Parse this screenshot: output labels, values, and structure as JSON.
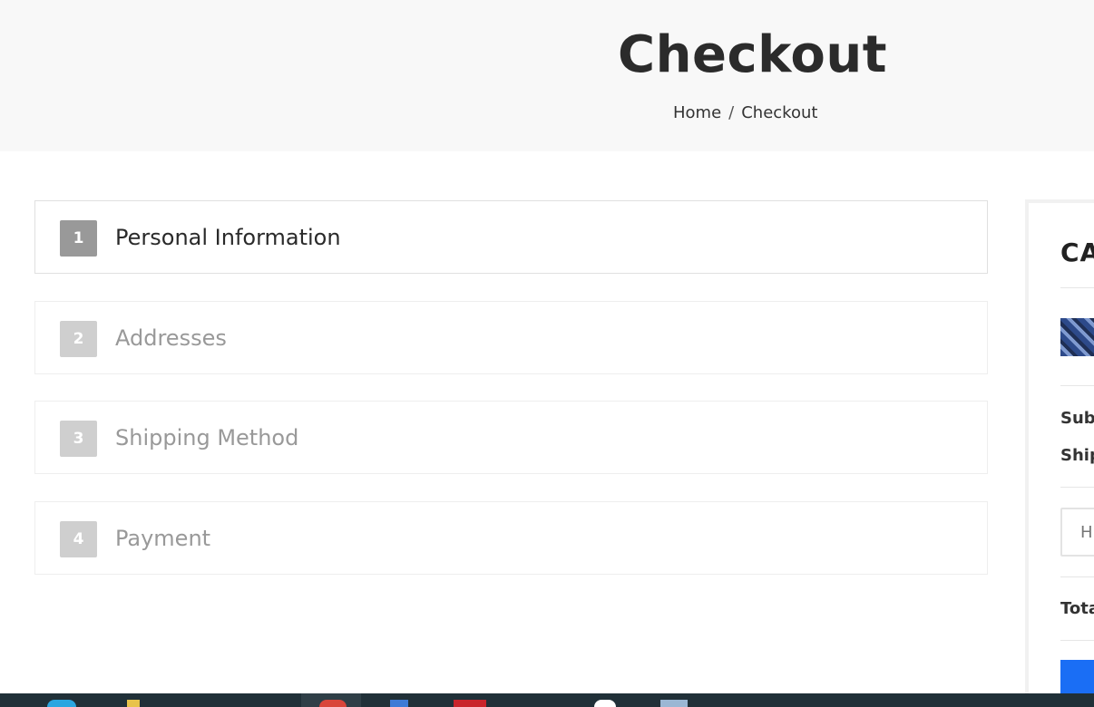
{
  "header": {
    "title": "Checkout",
    "breadcrumb": {
      "home": "Home",
      "separator": "/",
      "current": "Checkout"
    }
  },
  "steps": [
    {
      "number": "1",
      "label": "Personal Information",
      "state": "active"
    },
    {
      "number": "2",
      "label": "Addresses",
      "state": "inactive"
    },
    {
      "number": "3",
      "label": "Shipping Method",
      "state": "inactive"
    },
    {
      "number": "4",
      "label": "Payment",
      "state": "inactive"
    }
  ],
  "cart_summary": {
    "title": "CA",
    "subtotal_label": "Sub",
    "shipping_label": "Ship",
    "discount_placeholder": "H",
    "total_label": "Tota"
  },
  "colors": {
    "hero_bg": "#f8f8f8",
    "step_active_badge": "#999999",
    "step_inactive_badge": "#cfcfcf",
    "accent_button": "#1a6ef5",
    "taskbar": "#203038"
  },
  "taskbar": {
    "icons": [
      "edge-icon",
      "file-explorer-icon",
      "chrome-icon",
      "pinned-app-icon",
      "office-icon",
      "circle-app-icon",
      "pinned-app-icon-2"
    ]
  }
}
